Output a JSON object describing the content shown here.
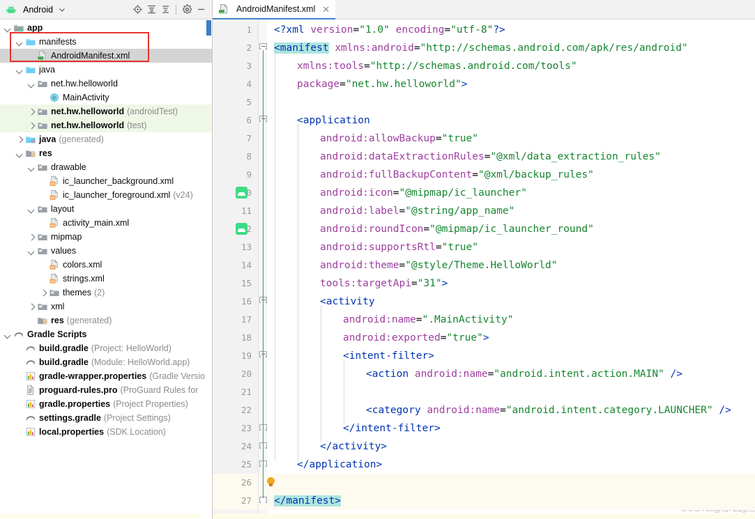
{
  "panel": {
    "title": "Android",
    "dropdown_icon": "chevron-down-icon",
    "toolbar_icons": [
      {
        "name": "locate-target-icon",
        "tooltip": "Select Opened File"
      },
      {
        "name": "expand-all-icon",
        "tooltip": "Expand All"
      },
      {
        "name": "collapse-all-icon",
        "tooltip": "Collapse All"
      },
      {
        "name": "settings-gear-icon",
        "tooltip": "Settings"
      },
      {
        "name": "minimize-icon",
        "tooltip": "Hide"
      }
    ],
    "tree": [
      {
        "indent": 0,
        "arrow": "down",
        "icon": "module-folder-icon",
        "label": "app",
        "sub": "",
        "bold": true,
        "state": ""
      },
      {
        "indent": 1,
        "arrow": "down",
        "icon": "folder-icon",
        "label": "manifests",
        "sub": "",
        "bold": false,
        "state": ""
      },
      {
        "indent": 2,
        "arrow": "none",
        "icon": "manifest-file-icon",
        "label": "AndroidManifest.xml",
        "sub": "",
        "bold": false,
        "state": "selected"
      },
      {
        "indent": 1,
        "arrow": "down",
        "icon": "folder-icon",
        "label": "java",
        "sub": "",
        "bold": false,
        "state": ""
      },
      {
        "indent": 2,
        "arrow": "down",
        "icon": "package-icon",
        "label": "net.hw.helloworld",
        "sub": "",
        "bold": false,
        "state": ""
      },
      {
        "indent": 3,
        "arrow": "none",
        "icon": "class-icon",
        "label": "MainActivity",
        "sub": "",
        "bold": false,
        "state": ""
      },
      {
        "indent": 2,
        "arrow": "right",
        "icon": "package-icon",
        "label": "net.hw.helloworld",
        "sub": "(androidTest)",
        "bold": true,
        "state": "green"
      },
      {
        "indent": 2,
        "arrow": "right",
        "icon": "package-icon",
        "label": "net.hw.helloworld",
        "sub": "(test)",
        "bold": true,
        "state": "green"
      },
      {
        "indent": 1,
        "arrow": "right",
        "icon": "generated-folder-icon",
        "label": "java",
        "sub": "(generated)",
        "bold": true,
        "state": ""
      },
      {
        "indent": 1,
        "arrow": "down",
        "icon": "res-folder-icon",
        "label": "res",
        "sub": "",
        "bold": true,
        "state": ""
      },
      {
        "indent": 2,
        "arrow": "down",
        "icon": "package-icon",
        "label": "drawable",
        "sub": "",
        "bold": false,
        "state": ""
      },
      {
        "indent": 3,
        "arrow": "none",
        "icon": "xml-file-icon",
        "label": "ic_launcher_background.xml",
        "sub": "",
        "bold": false,
        "state": ""
      },
      {
        "indent": 3,
        "arrow": "none",
        "icon": "xml-file-icon",
        "label": "ic_launcher_foreground.xml",
        "sub": "(v24)",
        "bold": false,
        "state": ""
      },
      {
        "indent": 2,
        "arrow": "down",
        "icon": "package-icon",
        "label": "layout",
        "sub": "",
        "bold": false,
        "state": ""
      },
      {
        "indent": 3,
        "arrow": "none",
        "icon": "xml-file-icon",
        "label": "activity_main.xml",
        "sub": "",
        "bold": false,
        "state": ""
      },
      {
        "indent": 2,
        "arrow": "right",
        "icon": "package-icon",
        "label": "mipmap",
        "sub": "",
        "bold": false,
        "state": ""
      },
      {
        "indent": 2,
        "arrow": "down",
        "icon": "package-icon",
        "label": "values",
        "sub": "",
        "bold": false,
        "state": ""
      },
      {
        "indent": 3,
        "arrow": "none",
        "icon": "xml-file-icon",
        "label": "colors.xml",
        "sub": "",
        "bold": false,
        "state": ""
      },
      {
        "indent": 3,
        "arrow": "none",
        "icon": "xml-file-icon",
        "label": "strings.xml",
        "sub": "",
        "bold": false,
        "state": ""
      },
      {
        "indent": 3,
        "arrow": "right",
        "icon": "package-icon",
        "label": "themes",
        "sub": "(2)",
        "bold": false,
        "state": ""
      },
      {
        "indent": 2,
        "arrow": "right",
        "icon": "package-icon",
        "label": "xml",
        "sub": "",
        "bold": false,
        "state": ""
      },
      {
        "indent": 2,
        "arrow": "none",
        "icon": "res-folder-icon",
        "label": "res",
        "sub": "(generated)",
        "bold": true,
        "state": ""
      },
      {
        "indent": 0,
        "arrow": "down",
        "icon": "gradle-icon",
        "label": "Gradle Scripts",
        "sub": "",
        "bold": true,
        "state": ""
      },
      {
        "indent": 1,
        "arrow": "none",
        "icon": "gradle-icon",
        "label": "build.gradle",
        "sub": "(Project: HelloWorld)",
        "bold": true,
        "state": ""
      },
      {
        "indent": 1,
        "arrow": "none",
        "icon": "gradle-icon",
        "label": "build.gradle",
        "sub": "(Module: HelloWorld.app)",
        "bold": true,
        "state": ""
      },
      {
        "indent": 1,
        "arrow": "none",
        "icon": "properties-icon",
        "label": "gradle-wrapper.properties",
        "sub": "(Gradle Versio",
        "bold": true,
        "state": ""
      },
      {
        "indent": 1,
        "arrow": "none",
        "icon": "text-file-icon",
        "label": "proguard-rules.pro",
        "sub": "(ProGuard Rules for ",
        "bold": true,
        "state": ""
      },
      {
        "indent": 1,
        "arrow": "none",
        "icon": "properties-icon",
        "label": "gradle.properties",
        "sub": "(Project Properties)",
        "bold": true,
        "state": ""
      },
      {
        "indent": 1,
        "arrow": "none",
        "icon": "gradle-icon",
        "label": "settings.gradle",
        "sub": "(Project Settings)",
        "bold": true,
        "state": ""
      },
      {
        "indent": 1,
        "arrow": "none",
        "icon": "properties-icon",
        "label": "local.properties",
        "sub": "(SDK Location)",
        "bold": true,
        "state": ""
      }
    ]
  },
  "editor": {
    "tab": {
      "icon": "manifest-file-icon",
      "label": "AndroidManifest.xml",
      "close": "✕"
    },
    "watermark_back": "CSDN @小白熊",
    "watermark_front": "CSDN @小@浅夏355",
    "lines": [
      {
        "n": 1,
        "indent": 0,
        "gutter_icon": "",
        "fold": "",
        "highlight": false,
        "tokens": [
          {
            "t": "<?xml ",
            "c": "tag"
          },
          {
            "t": "version",
            "c": "attr"
          },
          {
            "t": "=",
            "c": "plain"
          },
          {
            "t": "\"1.0\"",
            "c": "str"
          },
          {
            "t": " ",
            "c": "plain"
          },
          {
            "t": "encoding",
            "c": "attr"
          },
          {
            "t": "=",
            "c": "plain"
          },
          {
            "t": "\"utf-8\"",
            "c": "str"
          },
          {
            "t": "?>",
            "c": "tag"
          }
        ]
      },
      {
        "n": 2,
        "indent": 0,
        "gutter_icon": "",
        "fold": "start",
        "highlight": false,
        "tokens": [
          {
            "t": "<manifest",
            "c": "tag hl"
          },
          {
            "t": " ",
            "c": "plain"
          },
          {
            "t": "xmlns:android",
            "c": "attr"
          },
          {
            "t": "=",
            "c": "plain"
          },
          {
            "t": "\"http://schemas.android.com/apk/res/android\"",
            "c": "str"
          }
        ]
      },
      {
        "n": 3,
        "indent": 1,
        "gutter_icon": "",
        "fold": "",
        "highlight": false,
        "tokens": [
          {
            "t": "xmlns:tools",
            "c": "attr"
          },
          {
            "t": "=",
            "c": "plain"
          },
          {
            "t": "\"http://schemas.android.com/tools\"",
            "c": "str"
          }
        ]
      },
      {
        "n": 4,
        "indent": 1,
        "gutter_icon": "",
        "fold": "",
        "highlight": false,
        "tokens": [
          {
            "t": "package",
            "c": "attr"
          },
          {
            "t": "=",
            "c": "plain"
          },
          {
            "t": "\"net.hw.helloworld\"",
            "c": "str"
          },
          {
            "t": ">",
            "c": "tag"
          }
        ]
      },
      {
        "n": 5,
        "indent": 0,
        "gutter_icon": "",
        "fold": "",
        "highlight": false,
        "tokens": []
      },
      {
        "n": 6,
        "indent": 1,
        "gutter_icon": "",
        "fold": "start",
        "highlight": false,
        "tokens": [
          {
            "t": "<application",
            "c": "tag"
          }
        ]
      },
      {
        "n": 7,
        "indent": 2,
        "gutter_icon": "",
        "fold": "",
        "highlight": false,
        "tokens": [
          {
            "t": "android:allowBackup",
            "c": "attr"
          },
          {
            "t": "=",
            "c": "plain"
          },
          {
            "t": "\"true\"",
            "c": "str"
          }
        ]
      },
      {
        "n": 8,
        "indent": 2,
        "gutter_icon": "",
        "fold": "",
        "highlight": false,
        "tokens": [
          {
            "t": "android:dataExtractionRules",
            "c": "attr"
          },
          {
            "t": "=",
            "c": "plain"
          },
          {
            "t": "\"@xml/data_extraction_rules\"",
            "c": "str"
          }
        ]
      },
      {
        "n": 9,
        "indent": 2,
        "gutter_icon": "",
        "fold": "",
        "highlight": false,
        "tokens": [
          {
            "t": "android:fullBackupContent",
            "c": "attr"
          },
          {
            "t": "=",
            "c": "plain"
          },
          {
            "t": "\"@xml/backup_rules\"",
            "c": "str"
          }
        ]
      },
      {
        "n": 10,
        "indent": 2,
        "gutter_icon": "android-icon",
        "fold": "",
        "highlight": false,
        "tokens": [
          {
            "t": "android:icon",
            "c": "attr"
          },
          {
            "t": "=",
            "c": "plain"
          },
          {
            "t": "\"@mipmap/ic_launcher\"",
            "c": "str"
          }
        ]
      },
      {
        "n": 11,
        "indent": 2,
        "gutter_icon": "",
        "fold": "",
        "highlight": false,
        "tokens": [
          {
            "t": "android:label",
            "c": "attr"
          },
          {
            "t": "=",
            "c": "plain"
          },
          {
            "t": "\"@string/app_name\"",
            "c": "str"
          }
        ]
      },
      {
        "n": 12,
        "indent": 2,
        "gutter_icon": "android-icon",
        "fold": "",
        "highlight": false,
        "tokens": [
          {
            "t": "android:roundIcon",
            "c": "attr"
          },
          {
            "t": "=",
            "c": "plain"
          },
          {
            "t": "\"@mipmap/ic_launcher_round\"",
            "c": "str"
          }
        ]
      },
      {
        "n": 13,
        "indent": 2,
        "gutter_icon": "",
        "fold": "",
        "highlight": false,
        "tokens": [
          {
            "t": "android:supportsRtl",
            "c": "attr"
          },
          {
            "t": "=",
            "c": "plain"
          },
          {
            "t": "\"true\"",
            "c": "str"
          }
        ]
      },
      {
        "n": 14,
        "indent": 2,
        "gutter_icon": "",
        "fold": "",
        "highlight": false,
        "tokens": [
          {
            "t": "android:theme",
            "c": "attr"
          },
          {
            "t": "=",
            "c": "plain"
          },
          {
            "t": "\"@style/Theme.HelloWorld\"",
            "c": "str"
          }
        ]
      },
      {
        "n": 15,
        "indent": 2,
        "gutter_icon": "",
        "fold": "",
        "highlight": false,
        "tokens": [
          {
            "t": "tools:targetApi",
            "c": "attr"
          },
          {
            "t": "=",
            "c": "plain"
          },
          {
            "t": "\"31\"",
            "c": "str"
          },
          {
            "t": ">",
            "c": "tag"
          }
        ]
      },
      {
        "n": 16,
        "indent": 2,
        "gutter_icon": "",
        "fold": "start",
        "highlight": false,
        "tokens": [
          {
            "t": "<activity",
            "c": "tag"
          }
        ]
      },
      {
        "n": 17,
        "indent": 3,
        "gutter_icon": "",
        "fold": "",
        "highlight": false,
        "tokens": [
          {
            "t": "android:name",
            "c": "attr"
          },
          {
            "t": "=",
            "c": "plain"
          },
          {
            "t": "\".MainActivity\"",
            "c": "str"
          }
        ]
      },
      {
        "n": 18,
        "indent": 3,
        "gutter_icon": "",
        "fold": "",
        "highlight": false,
        "tokens": [
          {
            "t": "android:exported",
            "c": "attr"
          },
          {
            "t": "=",
            "c": "plain"
          },
          {
            "t": "\"true\"",
            "c": "str"
          },
          {
            "t": ">",
            "c": "tag"
          }
        ]
      },
      {
        "n": 19,
        "indent": 3,
        "gutter_icon": "",
        "fold": "start",
        "highlight": false,
        "tokens": [
          {
            "t": "<intent-filter>",
            "c": "tag"
          }
        ]
      },
      {
        "n": 20,
        "indent": 4,
        "gutter_icon": "",
        "fold": "",
        "highlight": false,
        "tokens": [
          {
            "t": "<action",
            "c": "tag"
          },
          {
            "t": " ",
            "c": "plain"
          },
          {
            "t": "android:name",
            "c": "attr"
          },
          {
            "t": "=",
            "c": "plain"
          },
          {
            "t": "\"android.intent.action.MAIN\"",
            "c": "str"
          },
          {
            "t": " ",
            "c": "plain"
          },
          {
            "t": "/>",
            "c": "tag"
          }
        ]
      },
      {
        "n": 21,
        "indent": 0,
        "gutter_icon": "",
        "fold": "",
        "highlight": false,
        "tokens": []
      },
      {
        "n": 22,
        "indent": 4,
        "gutter_icon": "",
        "fold": "",
        "highlight": false,
        "tokens": [
          {
            "t": "<category",
            "c": "tag"
          },
          {
            "t": " ",
            "c": "plain"
          },
          {
            "t": "android:name",
            "c": "attr"
          },
          {
            "t": "=",
            "c": "plain"
          },
          {
            "t": "\"android.intent.category.LAUNCHER\"",
            "c": "str"
          },
          {
            "t": " ",
            "c": "plain"
          },
          {
            "t": "/>",
            "c": "tag"
          }
        ]
      },
      {
        "n": 23,
        "indent": 3,
        "gutter_icon": "",
        "fold": "end",
        "highlight": false,
        "tokens": [
          {
            "t": "</intent-filter>",
            "c": "tag"
          }
        ]
      },
      {
        "n": 24,
        "indent": 2,
        "gutter_icon": "",
        "fold": "end",
        "highlight": false,
        "tokens": [
          {
            "t": "</activity>",
            "c": "tag"
          }
        ]
      },
      {
        "n": 25,
        "indent": 1,
        "gutter_icon": "",
        "fold": "end",
        "highlight": false,
        "tokens": [
          {
            "t": "</application>",
            "c": "tag"
          }
        ]
      },
      {
        "n": 26,
        "indent": 0,
        "gutter_icon": "",
        "fold": "",
        "highlight": true,
        "bulb": true,
        "tokens": []
      },
      {
        "n": 27,
        "indent": 0,
        "gutter_icon": "",
        "fold": "end",
        "highlight": true,
        "tokens": [
          {
            "t": "</manifest>",
            "c": "tag hl"
          }
        ]
      }
    ]
  },
  "colors": {
    "tag": "#0033b3",
    "attribute": "#9e3fa0",
    "string": "#16862f",
    "selection_highlight": "#aee5e0",
    "line_highlight": "#fdfaf0",
    "annotation_box": "#e8332c",
    "green_row": "#eff7e7",
    "tree_selection": "#d4d4d4",
    "android_green": "#3ddc84",
    "tab_underline": "#4083c9"
  }
}
